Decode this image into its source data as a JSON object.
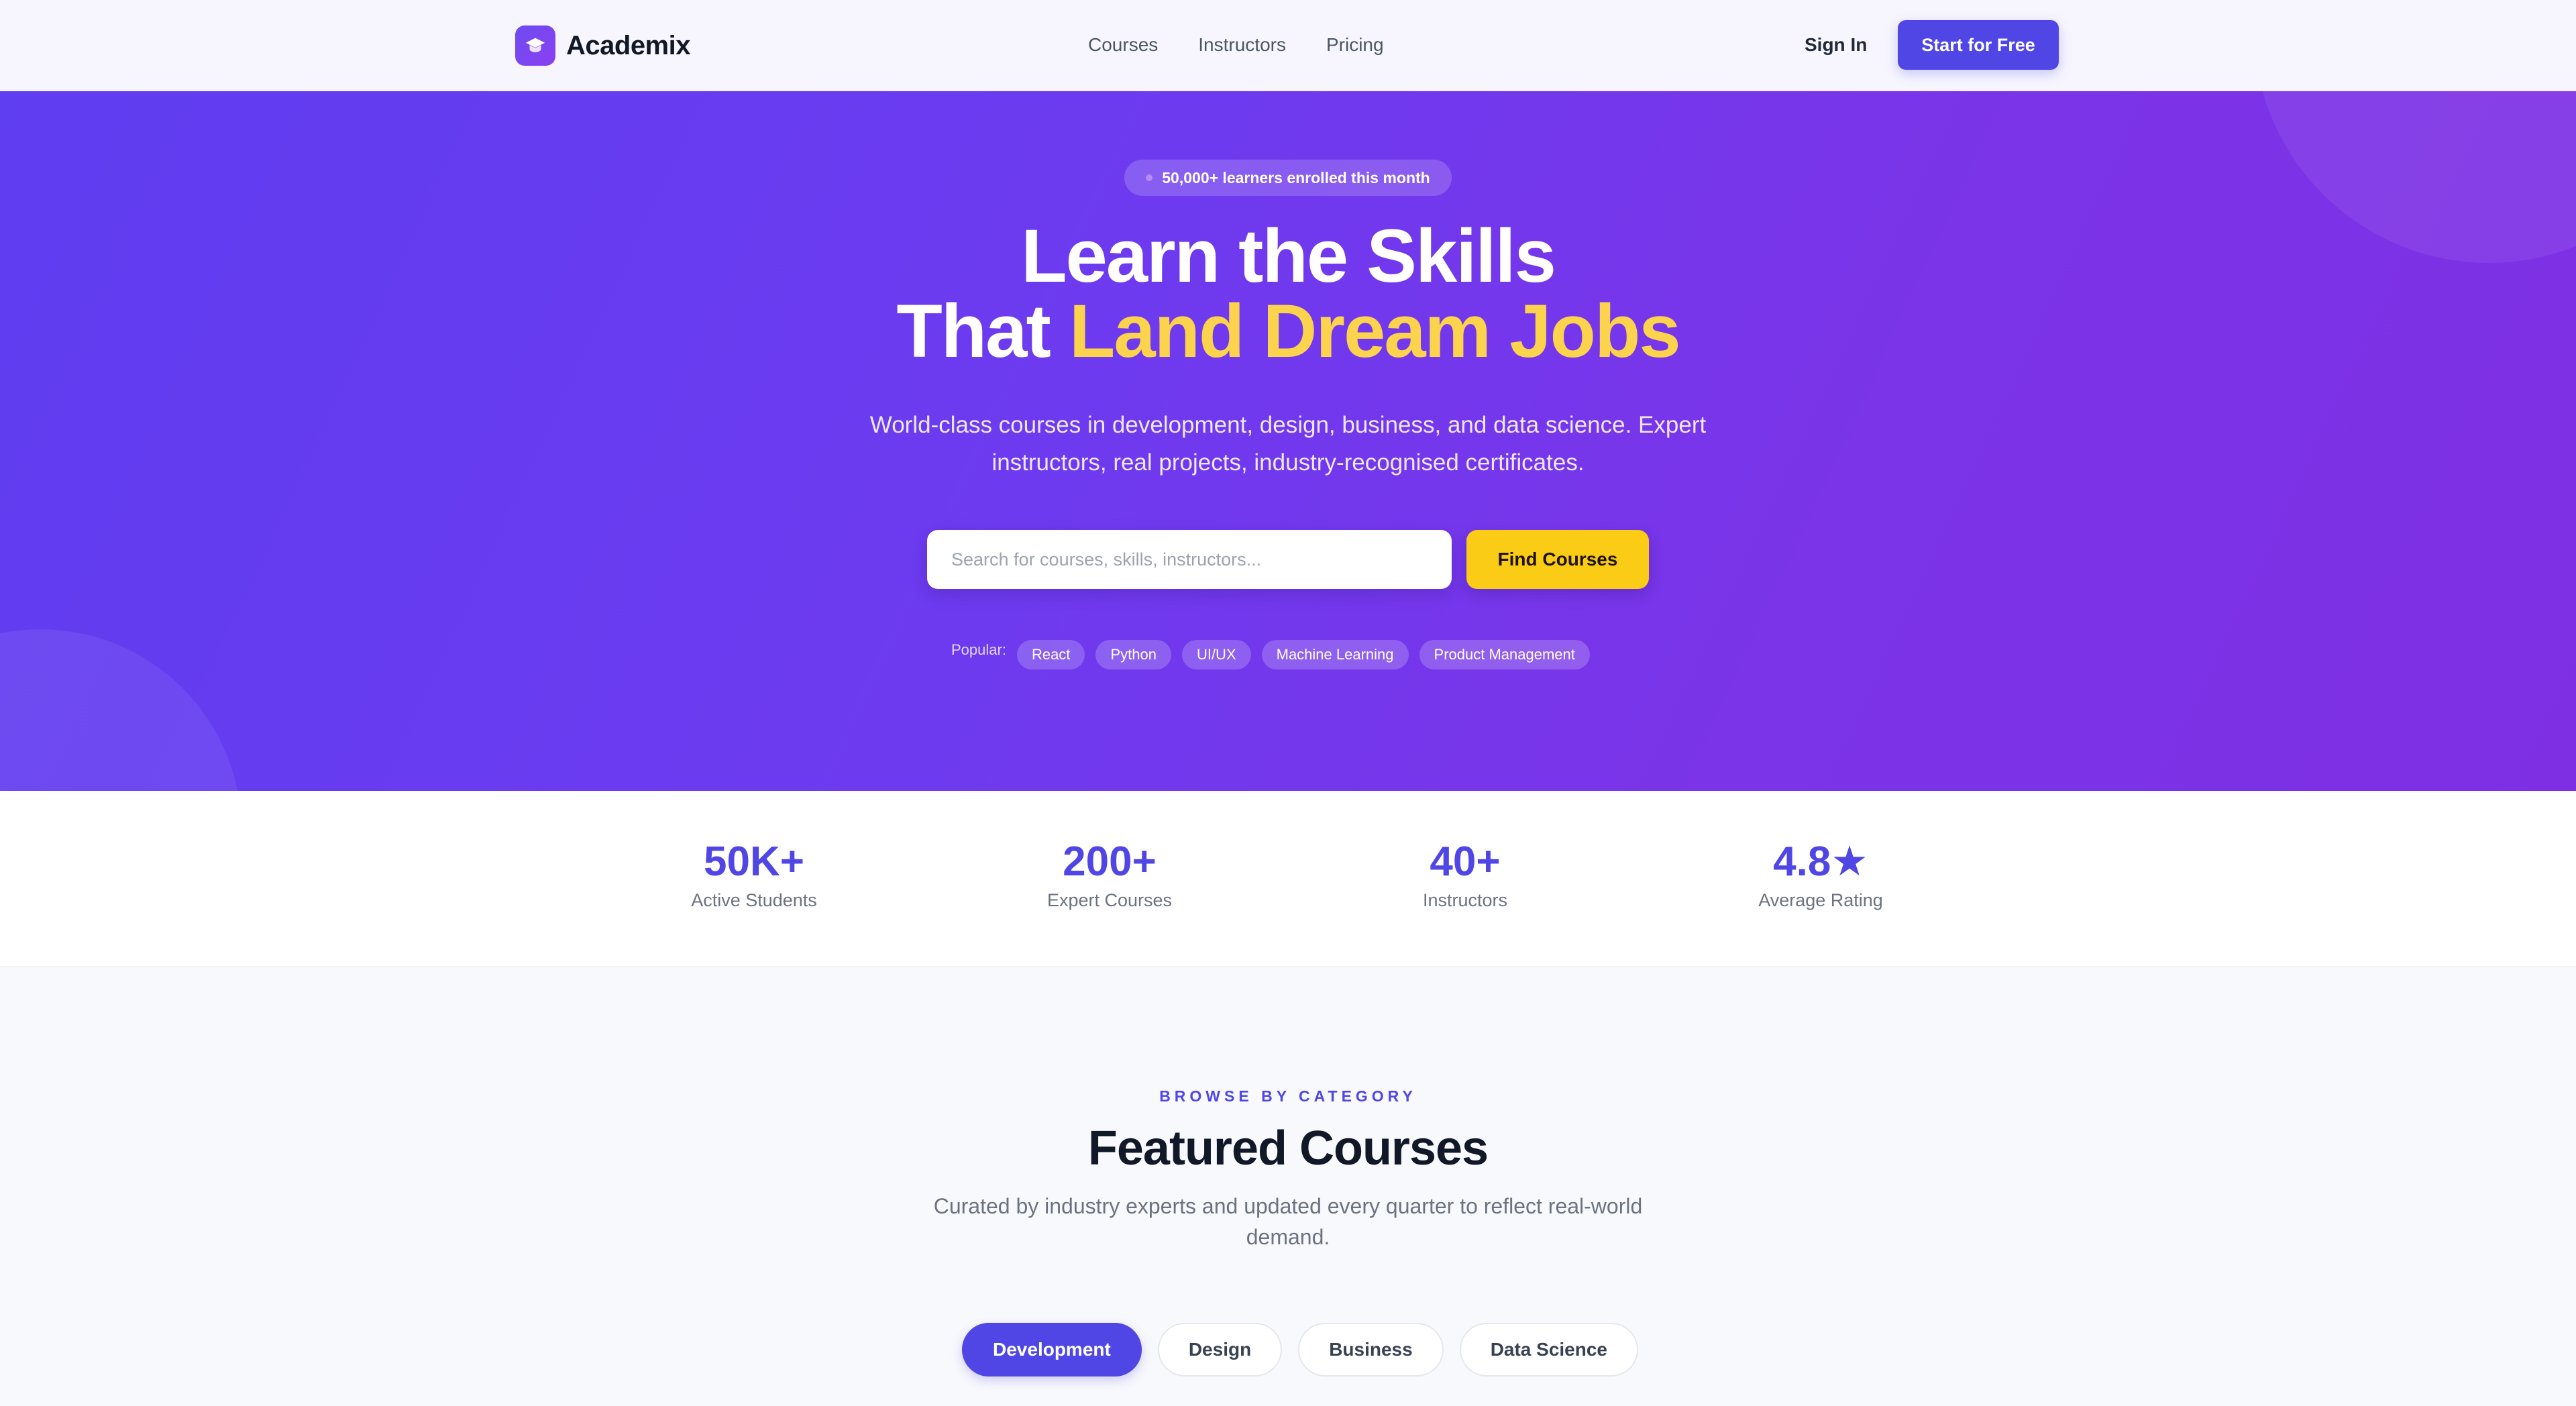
{
  "brand": {
    "name": "Academix",
    "icon": "graduation-cap-icon",
    "accent": "#4f46e5"
  },
  "nav": {
    "links": [
      "Courses",
      "Instructors",
      "Pricing"
    ],
    "sign_in": "Sign In",
    "cta": "Start for Free"
  },
  "hero": {
    "badge": "50,000+ learners enrolled this month",
    "title_line1": "Learn the Skills",
    "title_line2_prefix": "That ",
    "title_line2_accent": "Land Dream Jobs",
    "subtitle": "World-class courses in development, design, business, and data science. Expert instructors, real projects, industry-recognised certificates.",
    "search": {
      "placeholder": "Search for courses, skills, instructors...",
      "value": ""
    },
    "find_button": "Find Courses",
    "popular_label": "Popular:",
    "popular_tags": [
      "React",
      "Python",
      "UI/UX",
      "Machine Learning",
      "Product Management"
    ],
    "accent_color": "#fcd34d",
    "button_color": "#facc15"
  },
  "stats": [
    {
      "value": "50K+",
      "label": "Active Students"
    },
    {
      "value": "200+",
      "label": "Expert Courses"
    },
    {
      "value": "40+",
      "label": "Instructors"
    },
    {
      "value": "4.8★",
      "label": "Average Rating"
    }
  ],
  "featured": {
    "eyebrow": "BROWSE BY CATEGORY",
    "title": "Featured Courses",
    "subtitle": "Curated by industry experts and updated every quarter to reflect real-world demand.",
    "tabs": [
      "Development",
      "Design",
      "Business",
      "Data Science"
    ],
    "active_tab": "Development"
  }
}
